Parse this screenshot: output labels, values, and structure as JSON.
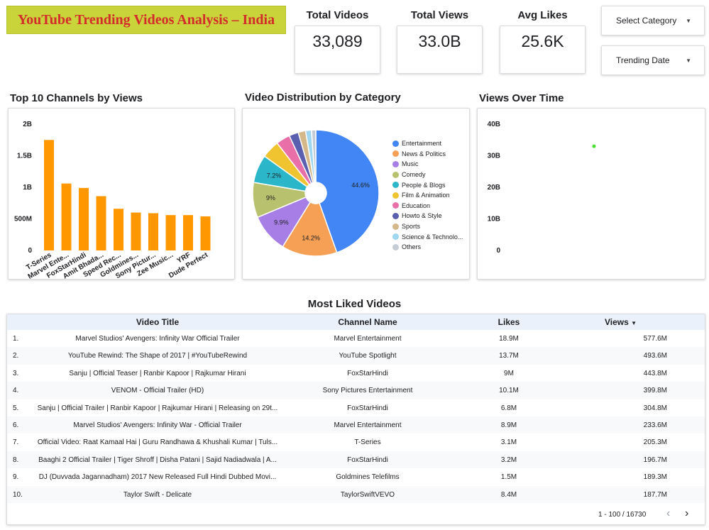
{
  "header": {
    "title": "YouTube Trending Videos Analysis – India"
  },
  "kpis": [
    {
      "label": "Total Videos",
      "value": "33,089"
    },
    {
      "label": "Total Views",
      "value": "33.0B"
    },
    {
      "label": "Avg Likes",
      "value": "25.6K"
    }
  ],
  "controls": {
    "category": "Select Category",
    "date": "Trending Date"
  },
  "icons": {
    "dropdown": "caret-down-icon",
    "prev": "chevron-left-icon",
    "next": "chevron-right-icon"
  },
  "colors": {
    "title_bg": "#c8d43a",
    "title_text": "#d42b2b",
    "bar": "#ff9800",
    "point": "#4ade30",
    "table_header": "#eaf1fb"
  },
  "charts": {
    "bar_title": "Top 10 Channels by Views",
    "pie_title": "Video Distribution by Category",
    "line_title": "Views Over Time"
  },
  "chart_data": [
    {
      "type": "bar",
      "title": "Top 10 Channels by Views",
      "categories": [
        "T-Series",
        "Marvel Ente...",
        "FoxStarHindi",
        "Amit Bhada...",
        "Speed Rec...",
        "Goldmines...",
        "Sony Pictur...",
        "Zee Music...",
        "YRF",
        "Dude Perfect"
      ],
      "values": [
        1.75,
        1.06,
        0.99,
        0.86,
        0.66,
        0.6,
        0.59,
        0.56,
        0.56,
        0.54
      ],
      "unit": "B",
      "ylim": [
        0,
        2
      ],
      "yticks": [
        "0",
        "500M",
        "1B",
        "1.5B",
        "2B"
      ],
      "color": "#ff9800",
      "grid": false
    },
    {
      "type": "pie",
      "title": "Video Distribution by Category",
      "legend_position": "right",
      "slices": [
        {
          "label": "Entertainment",
          "value": 44.6,
          "color": "#4285f4",
          "text": "44.6%"
        },
        {
          "label": "News & Politics",
          "value": 14.2,
          "color": "#f6a055",
          "text": "14.2%"
        },
        {
          "label": "Music",
          "value": 9.9,
          "color": "#a77ee6",
          "text": "9.9%"
        },
        {
          "label": "Comedy",
          "value": 9.0,
          "color": "#b8c26e",
          "text": "9%"
        },
        {
          "label": "People & Blogs",
          "value": 7.2,
          "color": "#2bb7c9",
          "text": "7.2%"
        },
        {
          "label": "Film & Animation",
          "value": 4.6,
          "color": "#f0c430",
          "text": ""
        },
        {
          "label": "Education",
          "value": 3.6,
          "color": "#e96fa8",
          "text": ""
        },
        {
          "label": "Howto & Style",
          "value": 2.4,
          "color": "#5a5fb0",
          "text": ""
        },
        {
          "label": "Sports",
          "value": 1.9,
          "color": "#d4b88a",
          "text": ""
        },
        {
          "label": "Science & Technolo...",
          "value": 1.5,
          "color": "#9fd6f0",
          "text": ""
        },
        {
          "label": "Others",
          "value": 1.1,
          "color": "#c5ccd6",
          "text": ""
        }
      ]
    },
    {
      "type": "scatter",
      "title": "Views Over Time",
      "yticks": [
        "0",
        "10B",
        "20B",
        "30B",
        "40B"
      ],
      "ylim": [
        0,
        40
      ],
      "unit": "B",
      "points": [
        {
          "x": "",
          "y": 33.0
        }
      ],
      "color": "#4ade30",
      "grid": false
    },
    {
      "type": "table",
      "title": "Most Liked Videos",
      "columns": [
        "Video Title",
        "Channel Name",
        "Likes",
        "Views"
      ],
      "sort": {
        "column": "Views",
        "direction": "desc"
      },
      "rows": [
        {
          "n": "1.",
          "title": "Marvel Studios' Avengers: Infinity War Official Trailer",
          "channel": "Marvel Entertainment",
          "likes": "18.9M",
          "views": "577.6M"
        },
        {
          "n": "2.",
          "title": "YouTube Rewind: The Shape of 2017 | #YouTubeRewind",
          "channel": "YouTube Spotlight",
          "likes": "13.7M",
          "views": "493.6M"
        },
        {
          "n": "3.",
          "title": "Sanju | Official Teaser | Ranbir Kapoor | Rajkumar Hirani",
          "channel": "FoxStarHindi",
          "likes": "9M",
          "views": "443.8M"
        },
        {
          "n": "4.",
          "title": "VENOM - Official Trailer (HD)",
          "channel": "Sony Pictures Entertainment",
          "likes": "10.1M",
          "views": "399.8M"
        },
        {
          "n": "5.",
          "title": "Sanju | Official Trailer | Ranbir Kapoor | Rajkumar Hirani | Releasing on 29t...",
          "channel": "FoxStarHindi",
          "likes": "6.8M",
          "views": "304.8M"
        },
        {
          "n": "6.",
          "title": "Marvel Studios' Avengers: Infinity War - Official Trailer",
          "channel": "Marvel Entertainment",
          "likes": "8.9M",
          "views": "233.6M"
        },
        {
          "n": "7.",
          "title": "Official Video: Raat Kamaal Hai | Guru Randhawa & Khushali Kumar | Tuls...",
          "channel": "T-Series",
          "likes": "3.1M",
          "views": "205.3M"
        },
        {
          "n": "8.",
          "title": "Baaghi 2 Official Trailer | Tiger Shroff | Disha Patani | Sajid Nadiadwala | A...",
          "channel": "FoxStarHindi",
          "likes": "3.2M",
          "views": "196.7M"
        },
        {
          "n": "9.",
          "title": "DJ (Duvvada Jagannadham) 2017 New Released Full Hindi Dubbed Movi...",
          "channel": "Goldmines Telefilms",
          "likes": "1.5M",
          "views": "189.3M"
        },
        {
          "n": "10.",
          "title": "Taylor Swift - Delicate",
          "channel": "TaylorSwiftVEVO",
          "likes": "8.4M",
          "views": "187.7M"
        }
      ],
      "pagination": "1 - 100 / 16730"
    }
  ]
}
